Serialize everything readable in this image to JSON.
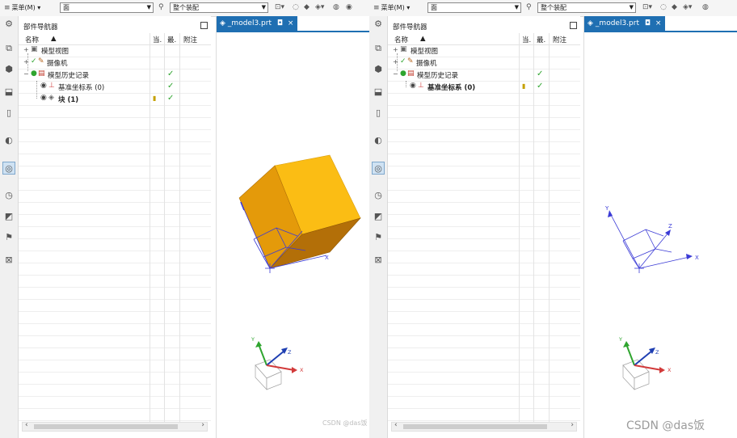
{
  "left": {
    "toolbar": {
      "menu_label": "菜单(M)",
      "filter_value": "面",
      "assembly_value": "整个装配"
    },
    "navigator": {
      "title": "部件导航器",
      "columns": {
        "name": "名称",
        "current": "当.",
        "latest": "最.",
        "notes": "附注"
      },
      "rows": [
        {
          "label": "模型视图",
          "icon": "model-view-icon"
        },
        {
          "label": "摄像机",
          "icon": "camera-icon"
        },
        {
          "label": "模型历史记录",
          "icon": "history-icon"
        },
        {
          "label": "基准坐标系 (0)",
          "icon": "datum-csys-icon"
        },
        {
          "label": "块 (1)",
          "icon": "block-icon"
        }
      ]
    },
    "tab": {
      "label": "_model3.prt",
      "pin": "◘",
      "close": "×"
    },
    "watermark": "CSDN @das饭"
  },
  "right": {
    "toolbar": {
      "menu_label": "菜单(M)",
      "filter_value": "面",
      "assembly_value": "整个装配"
    },
    "navigator": {
      "title": "部件导航器",
      "columns": {
        "name": "名称",
        "current": "当.",
        "latest": "最.",
        "notes": "附注"
      },
      "rows": [
        {
          "label": "模型视图",
          "icon": "model-view-icon"
        },
        {
          "label": "摄像机",
          "icon": "camera-icon"
        },
        {
          "label": "模型历史记录",
          "icon": "history-icon"
        },
        {
          "label": "基准坐标系 (0)",
          "icon": "datum-csys-icon"
        }
      ]
    },
    "tab": {
      "label": "_model3.prt",
      "pin": "◘",
      "close": "×"
    },
    "watermark": "CSDN @das饭"
  },
  "axes": {
    "x": "X",
    "y": "Y",
    "z": "Z"
  },
  "colors": {
    "cube_front": "#e49a0a",
    "cube_top": "#fbbd14",
    "cube_side": "#b36f08",
    "accent": "#1f6fb2",
    "check": "#2fa52f"
  }
}
